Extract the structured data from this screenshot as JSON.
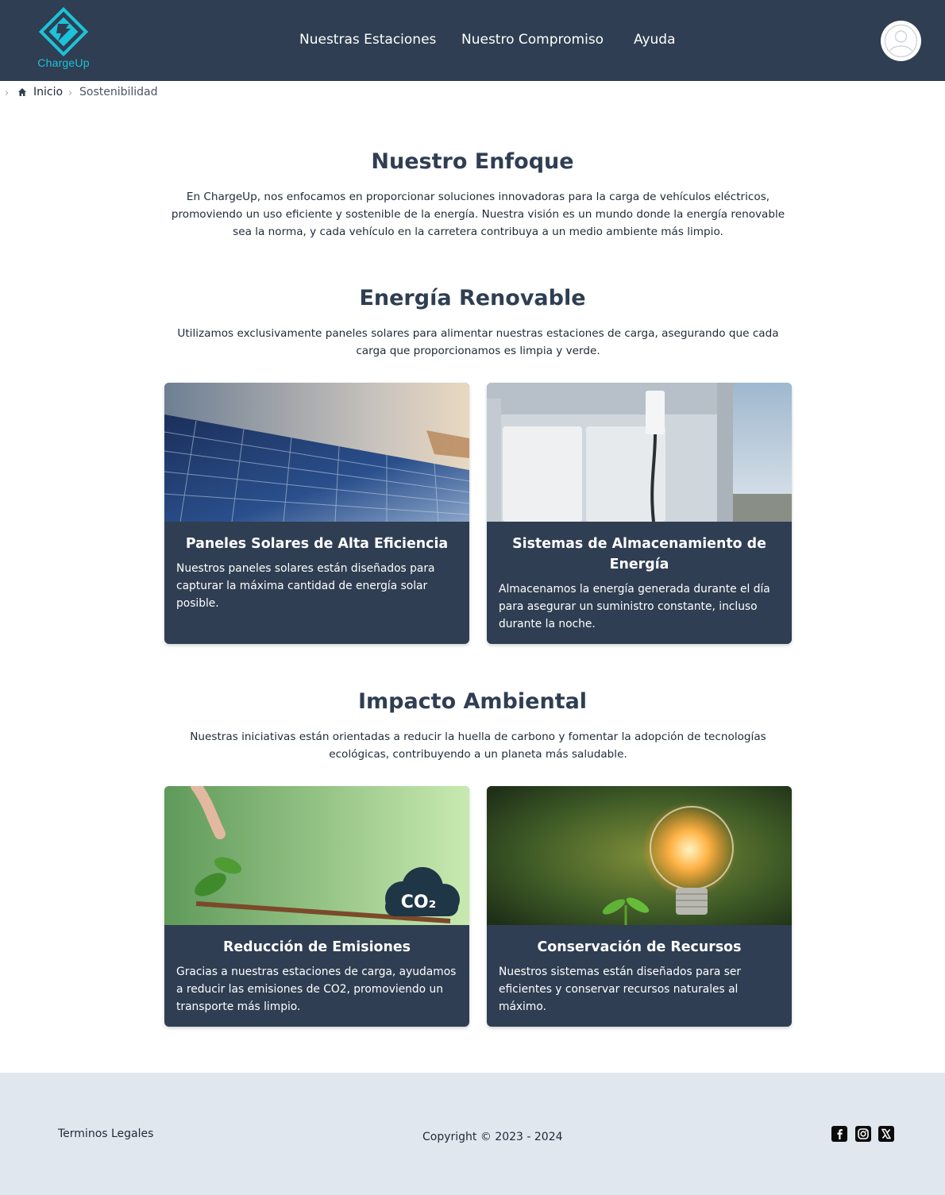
{
  "header": {
    "logo_text": "ChargeUp",
    "nav": [
      "Nuestras Estaciones",
      "Nuestro Compromiso",
      "Ayuda"
    ],
    "brand_color": "#1cc3d8",
    "bar_color": "#2f3e52"
  },
  "breadcrumb": {
    "home_label": "Inicio",
    "current_label": "Sostenibilidad"
  },
  "sections": {
    "enfoque": {
      "title": "Nuestro Enfoque",
      "text": "En ChargeUp, nos enfocamos en proporcionar soluciones innovadoras para la carga de vehículos eléctricos, promoviendo un uso eficiente y sostenible de la energía. Nuestra visión es un mundo donde la energía renovable sea la norma, y cada vehículo en la carretera contribuya a un medio ambiente más limpio."
    },
    "renovable": {
      "title": "Energía Renovable",
      "text": "Utilizamos exclusivamente paneles solares para alimentar nuestras estaciones de carga, asegurando que cada carga que proporcionamos es limpia y verde.",
      "cards": [
        {
          "title": "Paneles Solares de Alta Eficiencia",
          "text": "Nuestros paneles solares están diseñados para capturar la máxima cantidad de energía solar posible."
        },
        {
          "title": "Sistemas de Almacenamiento de Energía",
          "text": "Almacenamos la energía generada durante el día para asegurar un suministro constante, incluso durante la noche."
        }
      ]
    },
    "impacto": {
      "title": "Impacto Ambiental",
      "text": "Nuestras iniciativas están orientadas a reducir la huella de carbono y fomentar la adopción de tecnologías ecológicas, contribuyendo a un planeta más saludable.",
      "cards": [
        {
          "title": "Reducción de Emisiones",
          "text": "Gracias a nuestras estaciones de carga, ayudamos a reducir las emisiones de CO2, promoviendo un transporte más limpio.",
          "image_label": "CO₂"
        },
        {
          "title": "Conservación de Recursos",
          "text": "Nuestros sistemas están diseñados para ser eficientes y conservar recursos naturales al máximo."
        }
      ]
    }
  },
  "footer": {
    "legal": "Terminos Legales",
    "copyright": "Copyright © 2023 - 2024",
    "social_icons": [
      "facebook-icon",
      "instagram-icon",
      "x-icon"
    ]
  }
}
